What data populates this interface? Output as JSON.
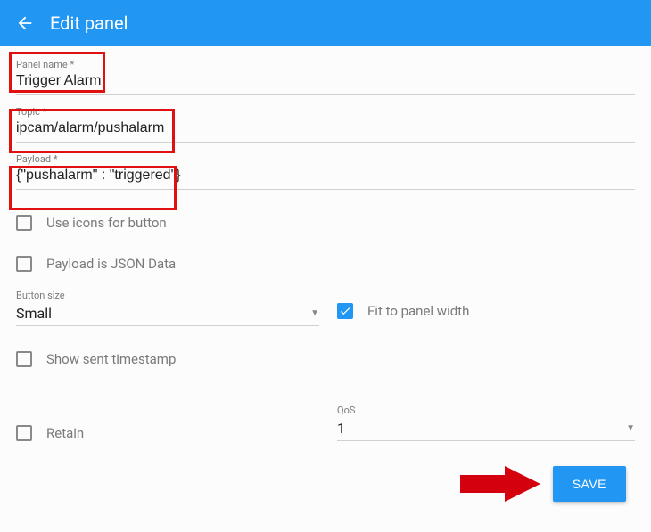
{
  "appbar": {
    "title": "Edit panel"
  },
  "fields": {
    "panelName": {
      "label": "Panel name *",
      "value": "Trigger Alarm"
    },
    "topic": {
      "label": "Topic *",
      "value": "ipcam/alarm/pushalarm"
    },
    "payload": {
      "label": "Payload *",
      "value": "{\"pushalarm\" : \"triggered\"}"
    }
  },
  "checks": {
    "useIcons": {
      "label": "Use icons for button",
      "checked": false
    },
    "payloadIsJson": {
      "label": "Payload is JSON Data",
      "checked": false
    },
    "fitToWidth": {
      "label": "Fit to panel width",
      "checked": true
    },
    "showTimestamp": {
      "label": "Show sent timestamp",
      "checked": false
    },
    "retain": {
      "label": "Retain",
      "checked": false
    }
  },
  "selects": {
    "buttonSize": {
      "label": "Button size",
      "value": "Small"
    },
    "qos": {
      "label": "QoS",
      "value": "1"
    }
  },
  "buttons": {
    "save": "SAVE"
  }
}
